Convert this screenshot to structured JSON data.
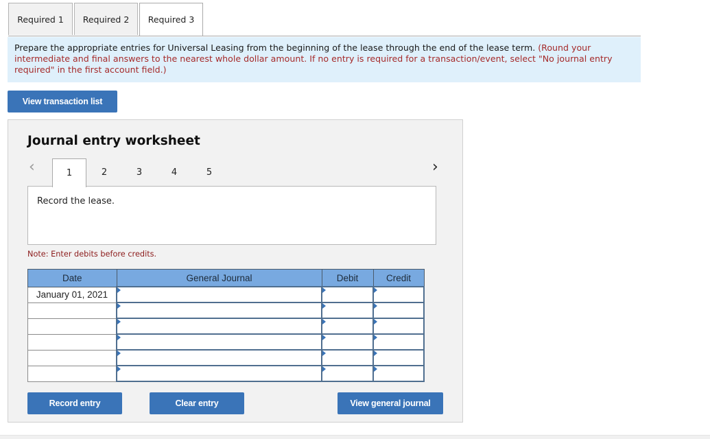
{
  "tabs": [
    {
      "label": "Required 1",
      "active": false
    },
    {
      "label": "Required 2",
      "active": false
    },
    {
      "label": "Required 3",
      "active": true
    }
  ],
  "instructions": {
    "main": "Prepare the appropriate entries for Universal Leasing from the beginning of the lease through the end of the lease term.",
    "note": "(Round your intermediate and final answers to the nearest whole dollar amount. If no entry is required for a transaction/event, select \"No journal entry required\" in the first account field.)"
  },
  "buttons": {
    "view_transaction_list": "View transaction list",
    "record_entry": "Record entry",
    "clear_entry": "Clear entry",
    "view_general_journal": "View general journal"
  },
  "worksheet": {
    "title": "Journal entry worksheet",
    "nav_prev_icon": "chevron-left-icon",
    "nav_next_icon": "chevron-right-icon",
    "entries": [
      "1",
      "2",
      "3",
      "4",
      "5"
    ],
    "active_entry": "1",
    "description": "Record the lease.",
    "note": "Note: Enter debits before credits.",
    "table": {
      "headers": [
        "Date",
        "General Journal",
        "Debit",
        "Credit"
      ],
      "rows": [
        {
          "date": "January 01, 2021",
          "account": "",
          "debit": "",
          "credit": ""
        },
        {
          "date": "",
          "account": "",
          "debit": "",
          "credit": ""
        },
        {
          "date": "",
          "account": "",
          "debit": "",
          "credit": ""
        },
        {
          "date": "",
          "account": "",
          "debit": "",
          "credit": ""
        },
        {
          "date": "",
          "account": "",
          "debit": "",
          "credit": ""
        },
        {
          "date": "",
          "account": "",
          "debit": "",
          "credit": ""
        }
      ]
    }
  },
  "colors": {
    "button_blue": "#3a74b8",
    "header_blue": "#78a9e0",
    "instructions_bg": "#dff0fb",
    "note_red": "#a52a2a"
  }
}
